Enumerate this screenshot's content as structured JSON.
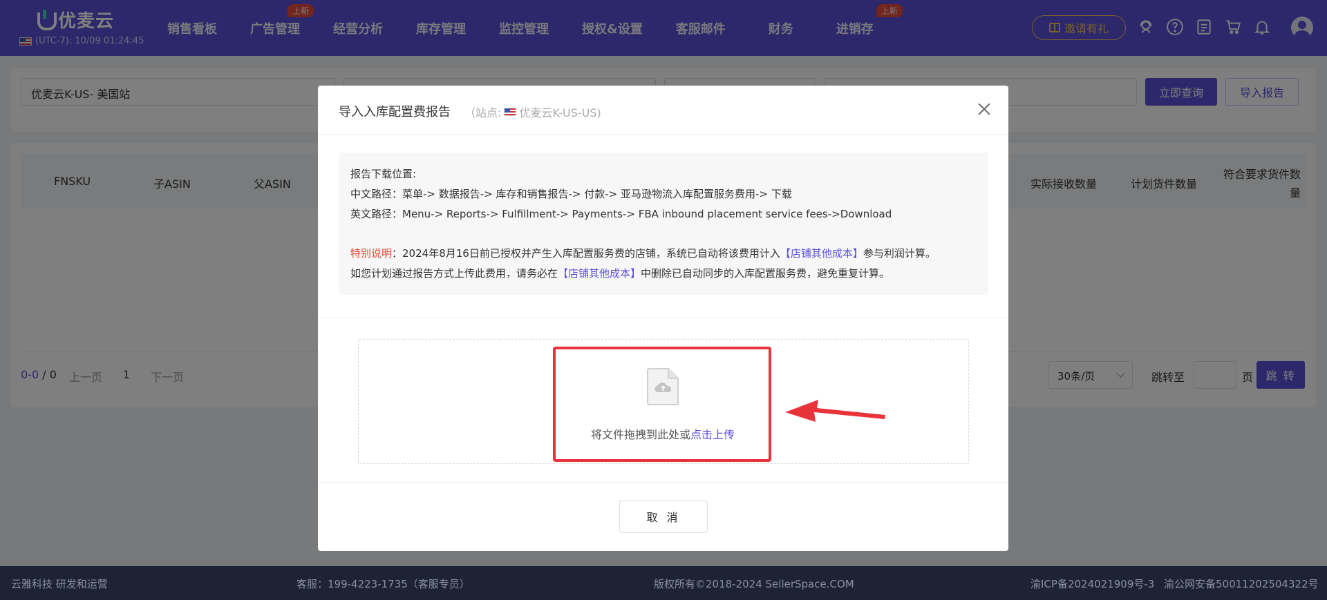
{
  "header": {
    "logo_text": "优麦云",
    "timezone": "(UTC-7): 10/09 01:24:45",
    "nav": [
      {
        "label": "销售看板",
        "badge": ""
      },
      {
        "label": "广告管理",
        "badge": "上新"
      },
      {
        "label": "经营分析",
        "badge": ""
      },
      {
        "label": "库存管理",
        "badge": ""
      },
      {
        "label": "监控管理",
        "badge": ""
      },
      {
        "label": "授权&设置",
        "badge": ""
      },
      {
        "label": "客服邮件",
        "badge": ""
      },
      {
        "label": "财务",
        "badge": ""
      },
      {
        "label": "进销存",
        "badge": "上新"
      }
    ],
    "invite_label": "邀请有礼"
  },
  "filter": {
    "store_value": "优麦云K-US- 美国站",
    "query_label": "立即查询",
    "import_label": "导入报告"
  },
  "table": {
    "columns": [
      "FNSKU",
      "子ASIN",
      "父ASIN",
      "实际接收数量",
      "计划货件数量",
      "符合要求货件数量"
    ]
  },
  "pager": {
    "count": "0-0",
    "total": "0",
    "prev": "上一页",
    "current": "1",
    "next": "下一页",
    "page_size": "30条/页",
    "jump_label": "跳转至",
    "page_unit": "页",
    "jump_button": "跳 转"
  },
  "footer": {
    "company": "云雅科技 研发和运营",
    "service": "客服：199-4223-1735（客服专员）",
    "copyright": "版权所有©2018-2024 SellerSpace.COM",
    "icp": "渝ICP备2024021909号-3",
    "police": "渝公网安备50011202504322号"
  },
  "modal": {
    "title": "导入入库配置费报告",
    "site_prefix": "（站点:",
    "site_name": "优麦云K-US-US)",
    "info_title": "报告下载位置:",
    "cn_path": "中文路径：菜单-> 数据报告-> 库存和销售报告-> 付款-> 亚马逊物流入库配置服务费用-> 下载",
    "en_path": "英文路径：Menu-> Reports-> Fulfillment-> Payments-> FBA inbound placement service fees->Download",
    "note_label": "特别说明",
    "note_1a": "：2024年8月16日前已授权并产生入库配置服务费的店铺，系统已自动将该费用计入",
    "note_link": "【店铺其他成本】",
    "note_1b": "参与利润计算。",
    "note_2a": "如您计划通过报告方式上传此费用，请务必在",
    "note_2b": "中删除已自动同步的入库配置服务费，避免重复计算。",
    "drop_text": "将文件拖拽到此处或",
    "upload_link": "点击上传",
    "cancel_label": "取 消"
  },
  "colors": {
    "brand": "#5b4fd6",
    "highlight": "#e8333a",
    "badge": "#e34b3c",
    "footer": "#1d2235"
  }
}
